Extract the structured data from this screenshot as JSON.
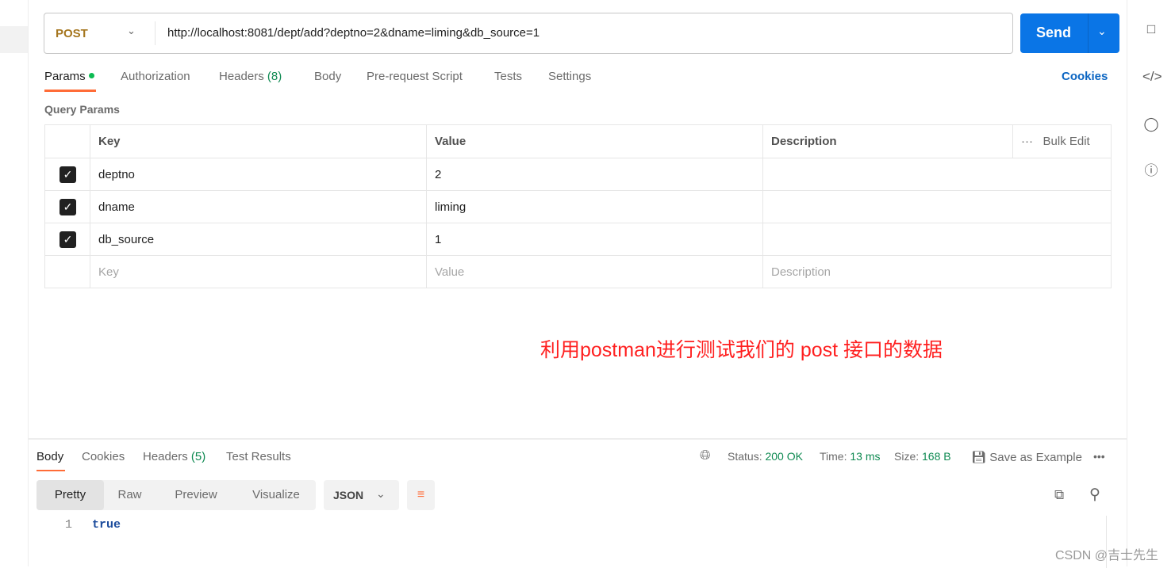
{
  "request": {
    "method": "POST",
    "url": "http://localhost:8081/dept/add?deptno=2&dname=liming&db_source=1",
    "send_label": "Send"
  },
  "tabs": [
    {
      "label": "Params"
    },
    {
      "label": "Authorization"
    },
    {
      "label": "Headers",
      "count": "(8)"
    },
    {
      "label": "Body"
    },
    {
      "label": "Pre-request Script"
    },
    {
      "label": "Tests"
    },
    {
      "label": "Settings"
    }
  ],
  "cookies_label": "Cookies",
  "query_params": {
    "title": "Query Params",
    "headers": [
      "Key",
      "Value",
      "Description"
    ],
    "bulk_edit": "Bulk Edit",
    "rows": [
      {
        "key": "deptno",
        "value": "2",
        "checked": true
      },
      {
        "key": "dname",
        "value": "liming",
        "checked": true
      },
      {
        "key": "db_source",
        "value": "1",
        "checked": true
      }
    ],
    "placeholders": {
      "key": "Key",
      "value": "Value",
      "description": "Description"
    }
  },
  "annotation": "利用postman进行测试我们的 post 接口的数据",
  "response": {
    "tabs": [
      {
        "label": "Body"
      },
      {
        "label": "Cookies"
      },
      {
        "label": "Headers",
        "count": "(5)"
      },
      {
        "label": "Test Results"
      }
    ],
    "status_label": "Status:",
    "status": "200 OK",
    "time_label": "Time:",
    "time": "13 ms",
    "size_label": "Size:",
    "size": "168 B",
    "save_example": "Save as Example",
    "views": [
      "Pretty",
      "Raw",
      "Preview",
      "Visualize"
    ],
    "format": "JSON",
    "line_number": "1",
    "body": "true"
  },
  "watermark": "CSDN @吉士先生",
  "colors": {
    "accent": "#ff6c37",
    "send": "#0a75e6",
    "success": "#0f8a52"
  }
}
